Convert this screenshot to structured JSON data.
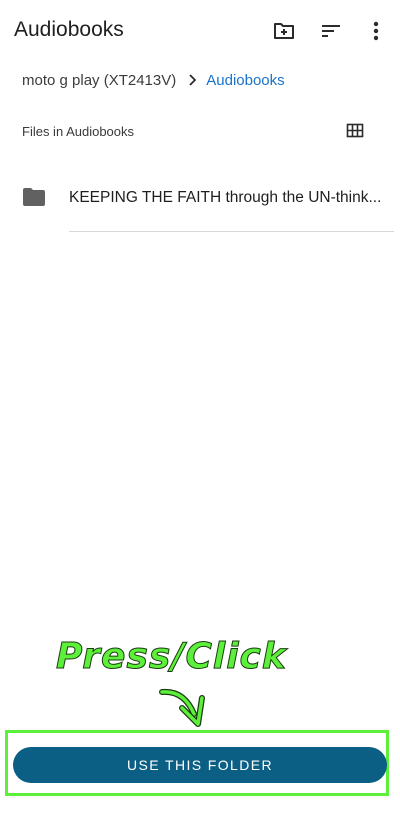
{
  "app_bar": {
    "title": "Audiobooks",
    "actions": [
      {
        "icon": "new-folder-icon"
      },
      {
        "icon": "sort-icon"
      },
      {
        "icon": "more-vert-icon"
      }
    ]
  },
  "breadcrumb": {
    "root": "moto g play (XT2413V)",
    "separator_icon": "chevron-right-icon",
    "current": "Audiobooks"
  },
  "section": {
    "label": "Files in Audiobooks",
    "view_toggle_icon": "grid-view-icon"
  },
  "files": [
    {
      "icon": "folder-icon",
      "name": "KEEPING THE FAITH through the UN-think..."
    }
  ],
  "annotation": {
    "text": "Press/Click",
    "arrow_icon": "curved-arrow-down-icon"
  },
  "primary_action": {
    "label": "USE THIS FOLDER"
  },
  "colors": {
    "accent": "#1a73c9",
    "button": "#0c5f84",
    "highlight": "#5cf03a"
  }
}
